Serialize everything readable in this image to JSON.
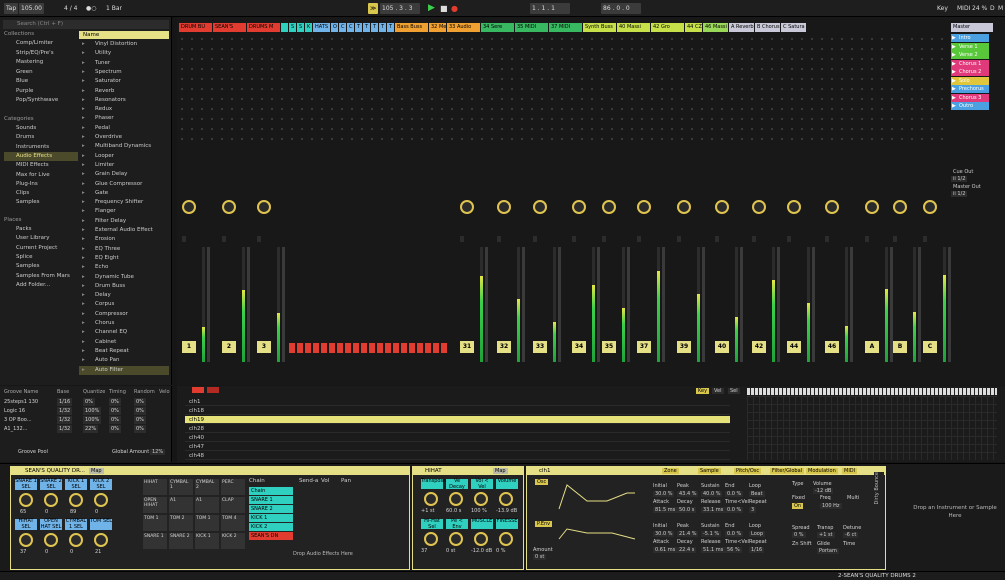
{
  "top": {
    "tap": "Tap",
    "tempo": "105.00",
    "sig": "4 / 4",
    "quant": "1 Bar",
    "pos": "105 .  3 .  3",
    "loop_start": "1 .  1 .  1",
    "loop_len": "86 .  0 .  0",
    "key": "Key",
    "midi": "MIDI",
    "cpu": "24 %",
    "d": "D",
    "m": "M"
  },
  "browser": {
    "search": "Search (Ctrl + F)",
    "collections_head": "Collections",
    "collections": [
      {
        "label": "Comp/Limiter",
        "color": "#e0602c"
      },
      {
        "label": "Strip/EQ/Pre's",
        "color": "#e08a2c"
      },
      {
        "label": "Mastering",
        "color": "#e3c53a"
      },
      {
        "label": "Green",
        "color": "#58c83a"
      },
      {
        "label": "Blue",
        "color": "#2e88e3"
      },
      {
        "label": "Purple",
        "color": "#a05ad8"
      },
      {
        "label": "Pop/Synthwave",
        "color": "#888"
      }
    ],
    "categories_head": "Categories",
    "categories": [
      "Sounds",
      "Drums",
      "Instruments",
      "Audio Effects",
      "MIDI Effects",
      "Max for Live",
      "Plug-Ins",
      "Clips",
      "Samples"
    ],
    "places_head": "Places",
    "places": [
      "Packs",
      "User Library",
      "Current Project",
      "Splice",
      "Samples",
      "Samples From Mars",
      "Add Folder..."
    ],
    "name_head": "Name",
    "devices": [
      "Vinyl Distortion",
      "Utility",
      "Tuner",
      "Spectrum",
      "Saturator",
      "Reverb",
      "Resonators",
      "Redux",
      "Phaser",
      "Pedal",
      "Overdrive",
      "Multiband Dynamics",
      "Looper",
      "Limiter",
      "Grain Delay",
      "Glue Compressor",
      "Gate",
      "Frequency Shifter",
      "Flanger",
      "Filter Delay",
      "External Audio Effect",
      "Erosion",
      "EQ Three",
      "EQ Eight",
      "Echo",
      "Dynamic Tube",
      "Drum Buss",
      "Delay",
      "Corpus",
      "Compressor",
      "Chorus",
      "Channel EQ",
      "Cabinet",
      "Beat Repeat",
      "Auto Pan",
      "Auto Filter"
    ]
  },
  "tracks": [
    {
      "name": "DRUM BU",
      "color": "#e23c30"
    },
    {
      "name": "SEAN'S",
      "color": "#e23c30"
    },
    {
      "name": "DRUMS M",
      "color": "#e23c30"
    },
    {
      "name": "",
      "color": "#2fd0c0"
    },
    {
      "name": "S",
      "color": "#2fd0c0"
    },
    {
      "name": "S",
      "color": "#2fd0c0"
    },
    {
      "name": "K",
      "color": "#2fd0c0"
    },
    {
      "name": "HATS",
      "color": "#6fb3e8"
    },
    {
      "name": "O",
      "color": "#6fb3e8"
    },
    {
      "name": "C",
      "color": "#6fb3e8"
    },
    {
      "name": "C",
      "color": "#6fb3e8"
    },
    {
      "name": "T",
      "color": "#6fb3e8"
    },
    {
      "name": "T",
      "color": "#6fb3e8"
    },
    {
      "name": "T",
      "color": "#6fb3e8"
    },
    {
      "name": "T",
      "color": "#6fb3e8"
    },
    {
      "name": "T",
      "color": "#6fb3e8"
    },
    {
      "name": "Bass Buss",
      "color": "#f0a030"
    },
    {
      "name": "32 Me",
      "color": "#f0a030"
    },
    {
      "name": "33 Audio",
      "color": "#f0a030"
    },
    {
      "name": "34 Sere",
      "color": "#38b860"
    },
    {
      "name": "35 MIDI",
      "color": "#38b860"
    },
    {
      "name": "37 MIDI",
      "color": "#38b860"
    },
    {
      "name": "Synth Buss",
      "color": "#c6e04a"
    },
    {
      "name": "40 Massi",
      "color": "#c6e04a"
    },
    {
      "name": "42 Gro",
      "color": "#c6e04a"
    },
    {
      "name": "44 CZ",
      "color": "#c6e04a"
    },
    {
      "name": "46 Massi",
      "color": "#9ad85a"
    },
    {
      "name": "A Reverb",
      "color": "#c8c8d8"
    },
    {
      "name": "B Chorus",
      "color": "#c8c8d8"
    },
    {
      "name": "C Satura",
      "color": "#c8c8d8"
    }
  ],
  "master": {
    "label": "Master",
    "scenes": [
      {
        "label": "Intro",
        "color": "#4aa0e0"
      },
      {
        "label": "Verse 1",
        "color": "#58c83a"
      },
      {
        "label": "Verse 2",
        "color": "#58c83a"
      },
      {
        "label": "Chorus 1",
        "color": "#e03a7a"
      },
      {
        "label": "Chorus 2",
        "color": "#e03a7a"
      },
      {
        "label": "Solo",
        "color": "#e0c63a"
      },
      {
        "label": "Prechorus",
        "color": "#4aa0e0"
      },
      {
        "label": "Chorus 3",
        "color": "#e03a7a"
      },
      {
        "label": "Outro",
        "color": "#4aa0e0"
      }
    ],
    "cue_out": "Cue Out",
    "cue_val": "ii 1/2",
    "master_out": "Master Out",
    "master_val": "ii 1/2"
  },
  "strip_numbers": [
    "1",
    "2",
    "3",
    "31",
    "32",
    "33",
    "34",
    "35",
    "37",
    "39",
    "40",
    "42",
    "44",
    "46",
    "A",
    "B",
    "C"
  ],
  "groove": {
    "title": "Groove Name",
    "cols": [
      "Base",
      "Quantize",
      "Timing",
      "Random",
      "Velo"
    ],
    "rows": [
      [
        "25steps1 130",
        "1/16",
        "0%",
        "0%",
        "0%"
      ],
      [
        "Logic 16",
        "1/32",
        "100%",
        "0%",
        "0%"
      ],
      [
        "3 OP Boo...",
        "1/32",
        "100%",
        "0%",
        "0%"
      ],
      [
        "A1_132...",
        "1/32",
        "22%",
        "0%",
        "0%"
      ]
    ],
    "pool": "Groove Pool",
    "global": "Global Amount",
    "global_val": "12%"
  },
  "clips": {
    "rows": [
      "clh1",
      "clh18",
      "clh19",
      "clh28",
      "clh40",
      "clh47",
      "clh48"
    ],
    "tabs": [
      "Key",
      "Vel",
      "Sel"
    ]
  },
  "drumrack": {
    "title": "SEAN'S QUALITY DR...",
    "map": "Map",
    "pads_top": [
      "SNARE 1 SEL",
      "SNARE 2 SEL",
      "KICK 1 SEL",
      "KICK 2 SEL"
    ],
    "pads_bot": [
      "HIHAT SEL",
      "OPEN HAT SEL",
      "CYMBAL 1 SEL",
      "TOM SEL"
    ],
    "knob_vals": [
      "65",
      "0",
      "89",
      "0",
      "37",
      "0",
      "0",
      "21"
    ],
    "cells": [
      "HIHAT",
      "CYMBAL 1",
      "CYMBAL 2",
      "PERC",
      "OPEN HIHAT",
      "A1",
      "A1",
      "CLAP",
      "TOM 1",
      "TOM 2",
      "TOM 1",
      "TOM 4",
      "SNARE 1",
      "SNARE 2",
      "KICK 1",
      "KICK 2"
    ],
    "chain_head": "Chain",
    "chains": [
      "Chain",
      "SNARE 1",
      "SNARE 2",
      "KICK 1",
      "KICK 2",
      "SEAN'S DN"
    ],
    "sends_head": "Send-a",
    "vol_head": "Vol",
    "pan_head": "Pan",
    "drop": "Drop Audio Effects Here"
  },
  "hihat": {
    "title": "HIHAT",
    "map": "Map",
    "macros": [
      "Transpose",
      "Ve Decay",
      "Vol < Vel",
      "Volume",
      "Hi-Hat Sel",
      "Pe < Env",
      "MUSCLE",
      "FINESSE"
    ],
    "vals": [
      "+1 st",
      "60.0 s",
      "100 %",
      "-13.9 dB",
      "37",
      "0 st",
      "-12.0 dB",
      "0 %"
    ]
  },
  "synth": {
    "title": "clh1",
    "tabs": [
      "Zone",
      "Sample",
      "Pitch/Osc",
      "Filter/Global",
      "Modulation",
      "MIDI"
    ],
    "osc": "Osc",
    "penv": "P.Env",
    "amount": "Amount",
    "amount_val": "0 st",
    "env_labels": [
      "Initial",
      "Peak",
      "Sustain",
      "End",
      "Loop"
    ],
    "env1": [
      "30.0 %",
      "43.4 %",
      "40.0 %",
      "0.0 %",
      "Beat"
    ],
    "env1b": [
      "Attack",
      "Decay",
      "Release",
      "Time<Vel",
      "Repeat"
    ],
    "env1c": [
      "81.5 ms",
      "50.0 s",
      "33.1 ms",
      "0.0 %",
      "3"
    ],
    "env2": [
      "30.0 %",
      "21.4 %",
      "-5.1 %",
      "0.0 %",
      "Loop"
    ],
    "env2c": [
      "0.61 ms",
      "22.4 s",
      "51.1 ms",
      "56 %",
      "1/16"
    ],
    "type": "Type",
    "fixed": "Fixed",
    "freq": "Freq",
    "fixed_val": "On",
    "freq_val": "100 Hz",
    "volume": "Volume",
    "vol_val": "-12 dB",
    "mult": "Multi",
    "spread": "Spread",
    "spread_val": "0 %",
    "transp": "Transp",
    "transp_val": "+1 st",
    "detune": "Detune",
    "detune_val": "-6 ct",
    "zoom": "Zn Shift",
    "glide": "Glide",
    "glide_val": "Portam",
    "time": "Time"
  },
  "dirty": "Dirty Bounce",
  "drop_inst": "Drop an Instrument or Sample Here",
  "status": "2-SEAN'S QUALITY DRUMS 2"
}
